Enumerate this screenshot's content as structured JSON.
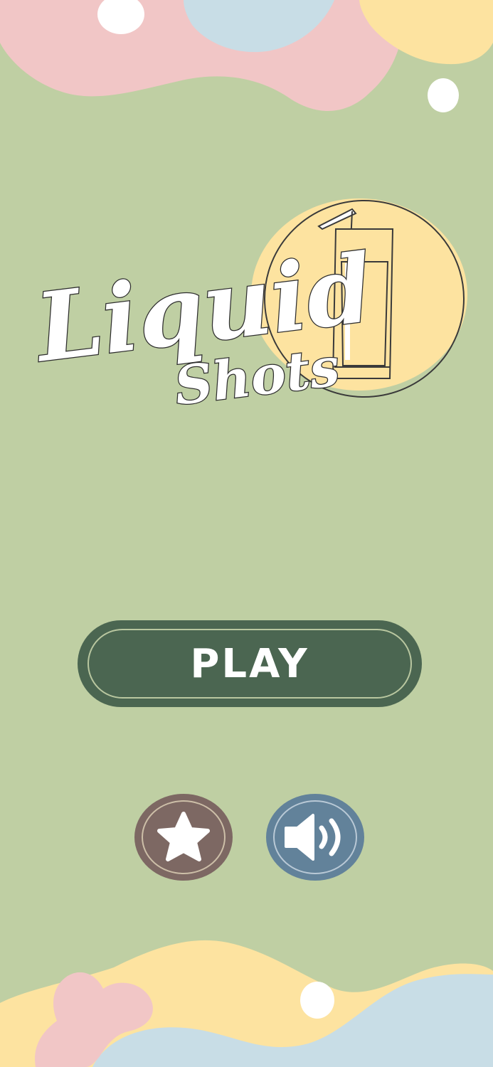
{
  "game": {
    "title_line1": "Liquid",
    "title_line2": "Shots"
  },
  "menu": {
    "play_label": "PLAY",
    "rate_icon": "star-icon",
    "sound_icon": "speaker-sound-on-icon"
  },
  "colors": {
    "background": "#bfcfa3",
    "play_button": "#4b6651",
    "rate_button": "#7d6863",
    "sound_button": "#62829a",
    "blob_pink": "#f1c6c6",
    "blob_blue": "#c8dde6",
    "blob_yellow": "#fde3a0",
    "logo_circle": "#fde3a0"
  }
}
